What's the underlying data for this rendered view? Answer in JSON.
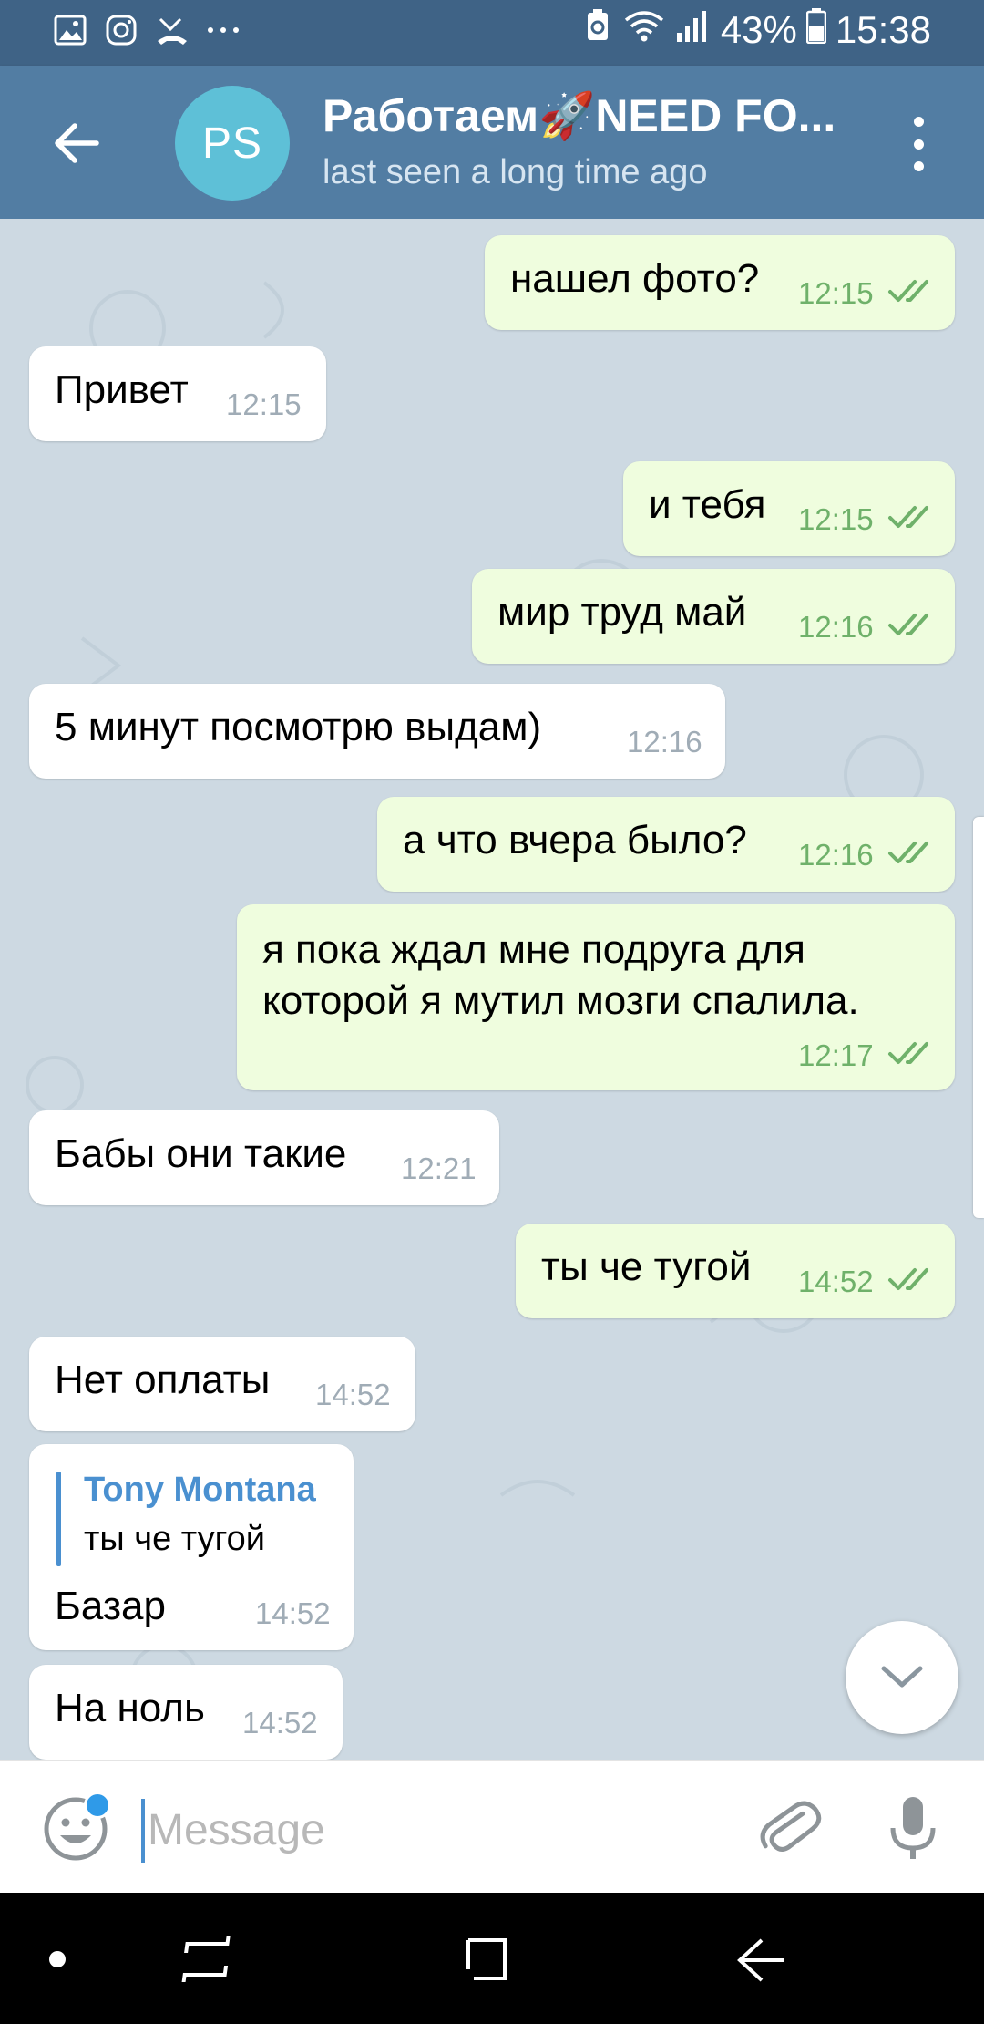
{
  "status_bar": {
    "battery_percent": "43%",
    "time": "15:38",
    "left_icons": [
      "image-icon",
      "instagram-icon",
      "missed-call-icon",
      "more-dots-icon"
    ]
  },
  "header": {
    "back_icon": "arrow-left-icon",
    "avatar_initials": "PS",
    "avatar_color": "#5ec0d7",
    "title": "Работаем🚀NEED FO...",
    "subtitle": "last seen a long time ago",
    "menu_icon": "more-vertical-icon"
  },
  "messages": [
    {
      "dir": "out",
      "text": "нашел фото?",
      "time": "12:15",
      "read": true
    },
    {
      "dir": "in",
      "text": "Привет",
      "time": "12:15"
    },
    {
      "dir": "out",
      "text": "и тебя",
      "time": "12:15",
      "read": true
    },
    {
      "dir": "out",
      "text": "мир труд май",
      "time": "12:16",
      "read": true
    },
    {
      "dir": "in",
      "text": "5 минут посмотрю выдам)",
      "time": "12:16"
    },
    {
      "dir": "out",
      "text": "а что вчера было?",
      "time": "12:16",
      "read": true
    },
    {
      "dir": "out",
      "lines": [
        "я пока ждал мне подруга для",
        "которой я мутил мозги спалила."
      ],
      "time": "12:17",
      "read": true
    },
    {
      "dir": "in",
      "text": "Бабы они такие",
      "time": "12:21"
    },
    {
      "dir": "out",
      "text": "ты че тугой",
      "time": "14:52",
      "read": true
    },
    {
      "dir": "in",
      "text": "Нет оплаты",
      "time": "14:52"
    },
    {
      "dir": "in",
      "reply": {
        "name": "Tony Montana",
        "text": "ты че тугой"
      },
      "text": "Базар",
      "time": "14:52"
    },
    {
      "dir": "in",
      "text": "На ноль",
      "time": "14:52"
    }
  ],
  "input": {
    "placeholder": "Message",
    "emoji_icon": "smile-icon",
    "attach_icon": "paperclip-icon",
    "mic_icon": "microphone-icon"
  },
  "scroll_down_icon": "chevron-down-icon",
  "nav": [
    "nav-dot",
    "recents-icon",
    "home-icon",
    "back-icon"
  ],
  "colors": {
    "header": "#527da3",
    "status_bar": "#3f6386",
    "outgoing_bubble": "#effdde",
    "incoming_bubble": "#ffffff",
    "read_check": "#6fb16a",
    "reply_accent": "#4a90d0"
  }
}
